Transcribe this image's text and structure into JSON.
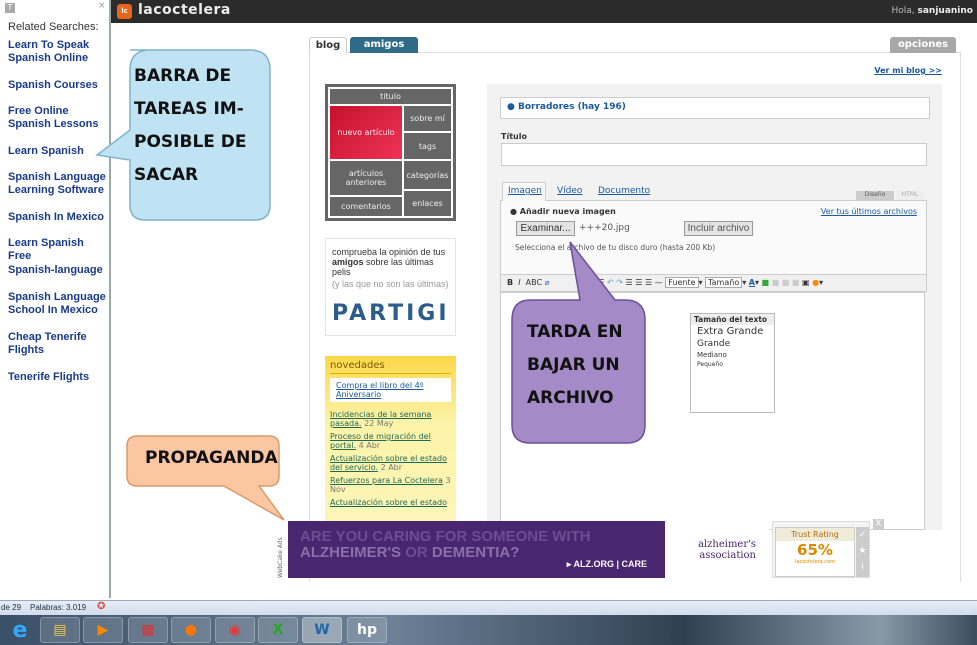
{
  "sidebar": {
    "close": "×",
    "title_icon": "T",
    "heading": "Related Searches:",
    "items": [
      "Learn To Speak Spanish Online",
      "Spanish Courses",
      "Free Online Spanish Lessons",
      "Learn Spanish",
      "Spanish Language Learning Software",
      "Spanish In Mexico",
      "Learn Spanish Free",
      "Spanish-language",
      "Spanish Language School In Mexico",
      "Cheap Tenerife Flights",
      "Tenerife Flights"
    ]
  },
  "header": {
    "logo": "lc",
    "brand": "lacoctelera",
    "greeting": "Hola,",
    "user": "sanjuanino"
  },
  "tabs": {
    "blog": "blog",
    "amigos": "amigos",
    "opciones": "opciones"
  },
  "ver_mi_blog": "Ver mi blog >>",
  "menu": {
    "titulo": "titulo",
    "nuevo": "nuevo artículo",
    "sobre": "sobre mí",
    "tags": "tags",
    "anteriores": "artículos anteriores",
    "categorias": "categorías",
    "comentarios": "comentarios",
    "enlaces": "enlaces"
  },
  "partigi": {
    "line1": "comprueba la opinión de tus",
    "bold": "amigos",
    "line2": " sobre las últimas pelis",
    "line3": "(y las que no son las últimas)",
    "logo": "PARTIGI"
  },
  "novedades": {
    "title": "novedades",
    "featured": "Compra el libro del 4º Aniversario",
    "items": [
      {
        "t": "Incidencias de la semana pasada.",
        "d": "22 May"
      },
      {
        "t": "Proceso de migración del portal.",
        "d": "4 Abr"
      },
      {
        "t": "Actualización sobre el estado del servicio.",
        "d": "2 Abr"
      },
      {
        "t": "Refuerzos para La Coctelera",
        "d": "3 Nov"
      },
      {
        "t": "Actualización sobre el estado",
        "d": ""
      }
    ]
  },
  "editor": {
    "borradores": "Borradores (hay 196)",
    "titulo_label": "Título",
    "titulo_value": "",
    "media_tabs": [
      "Imagen",
      "Vídeo",
      "Documento"
    ],
    "mode_tabs": [
      "Diseño",
      "HTML"
    ],
    "add_image": "Añadir nueva imagen",
    "ver_archivos": "Ver tus últimos archivos",
    "browse": "Examinar...",
    "file": "+++20.jpg",
    "include": "Incluir archivo",
    "hint": "Selecciona el archivo de tu disco duro (hasta 200 Kb)",
    "font": "Fuente",
    "size": "Tamaño",
    "size_menu": {
      "title": "Tamaño del texto",
      "options": [
        "Extra Grande",
        "Grande",
        "Mediano",
        "Pequeño"
      ]
    }
  },
  "callouts": {
    "barra": [
      "BARRA DE",
      "TAREAS IM-",
      "POSIBLE DE",
      "SACAR"
    ],
    "tarda": [
      "TARDA EN",
      "BAJAR UN",
      "ARCHIVO"
    ],
    "propaganda": "PROPAGANDA"
  },
  "ad": {
    "label": "WebCake Ads",
    "line1": "ARE YOU CARING FOR SOMEONE WITH",
    "line2a": "ALZHEIMER'S",
    "line2b": " OR ",
    "line2c": "DEMENTIA?",
    "cta": "▸ ALZ.ORG | CARE",
    "org1": "alzheimer's",
    "org2": "association",
    "close": "X"
  },
  "trust": {
    "title": "Trust Rating",
    "value": "65%",
    "site": "lacoctelera.com"
  },
  "statusbar": {
    "page": "de 29",
    "words": "Palabras: 3.019"
  },
  "taskbar": {
    "apps": [
      "internet-explorer",
      "file-explorer",
      "media-player",
      "acrobat",
      "firefox",
      "chrome",
      "excel",
      "word",
      "hp"
    ]
  }
}
